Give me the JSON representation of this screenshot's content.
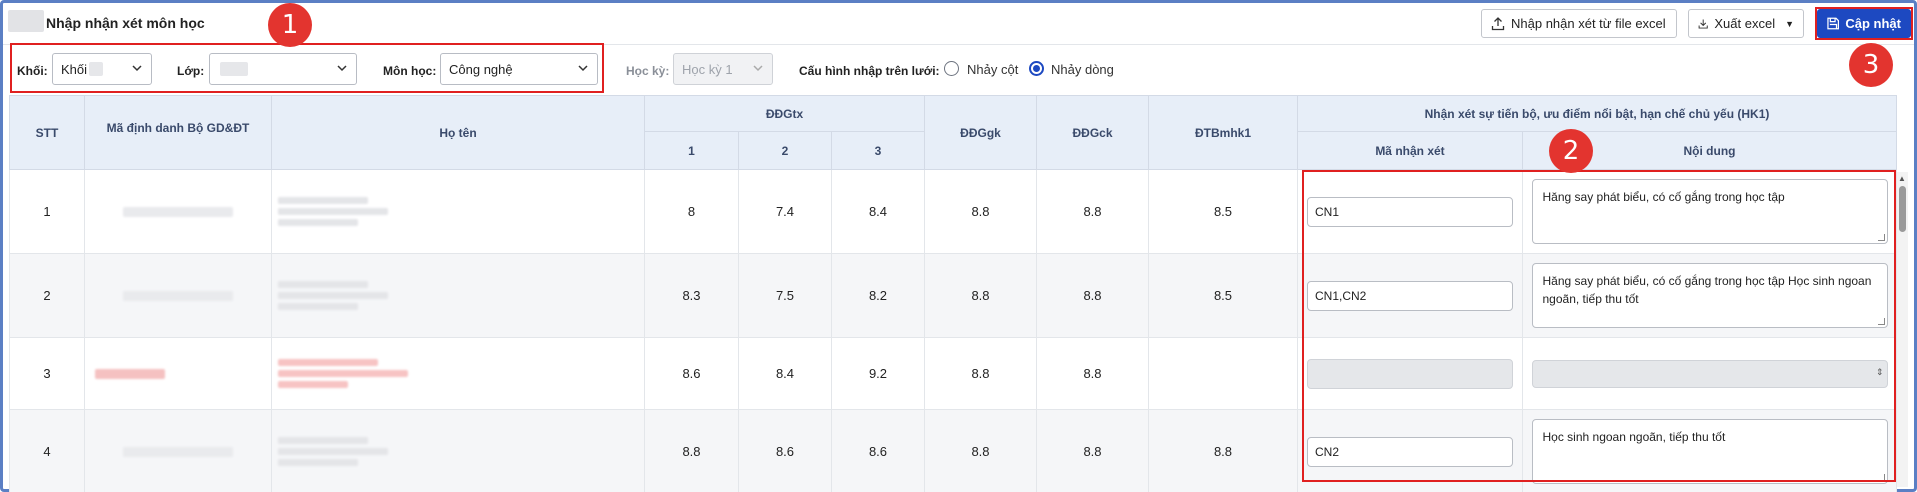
{
  "header": {
    "title": "Nhập nhận xét môn học",
    "import_label": "Nhập nhận xét từ file excel",
    "export_label": "Xuất excel",
    "update_label": "Cập nhật"
  },
  "filters": {
    "khoi_label": "Khối:",
    "khoi_value": "Khối",
    "lop_label": "Lớp:",
    "lop_value": "",
    "monhoc_label": "Môn học:",
    "monhoc_value": "Công nghệ",
    "hocky_label": "Học kỳ:",
    "hocky_value": "Học kỳ 1",
    "config_label": "Cấu hình nhập trên lưới:",
    "radio_col_label": "Nhảy cột",
    "radio_row_label": "Nhảy dòng",
    "radio_selected": "Nhảy dòng"
  },
  "table": {
    "headers": {
      "stt": "STT",
      "ma_dinh_danh": "Mã định danh Bộ GD&ĐT",
      "ho_ten": "Họ tên",
      "ddgtx": "ĐĐGtx",
      "ddgtx_1": "1",
      "ddgtx_2": "2",
      "ddgtx_3": "3",
      "ddggk": "ĐĐGgk",
      "ddgck": "ĐĐGck",
      "dtbmhk1": "ĐTBmhk1",
      "nhan_xet_group": "Nhận xét sự tiến bộ, ưu điểm nổi bật, hạn chế chủ yếu (HK1)",
      "ma_nhan_xet": "Mã nhận xét",
      "noi_dung": "Nội dung"
    },
    "rows": [
      {
        "stt": "1",
        "tx1": "8",
        "tx2": "7.4",
        "tx3": "8.4",
        "gk": "8.8",
        "ck": "8.8",
        "tb": "8.5",
        "ma": "CN1",
        "noidung": "Hăng say phát biểu, có cố gắng trong học tập"
      },
      {
        "stt": "2",
        "tx1": "8.3",
        "tx2": "7.5",
        "tx3": "8.2",
        "gk": "8.8",
        "ck": "8.8",
        "tb": "8.5",
        "ma": "CN1,CN2",
        "noidung": "Hăng say phát biểu, có cố gắng trong học tập Học sinh ngoan ngoãn, tiếp thu tốt"
      },
      {
        "stt": "3",
        "tx1": "8.6",
        "tx2": "8.4",
        "tx3": "9.2",
        "gk": "8.8",
        "ck": "8.8",
        "tb": "",
        "ma": "",
        "noidung": ""
      },
      {
        "stt": "4",
        "tx1": "8.8",
        "tx2": "8.6",
        "tx3": "8.6",
        "gk": "8.8",
        "ck": "8.8",
        "tb": "8.8",
        "ma": "CN2",
        "noidung": "Học sinh ngoan ngoãn, tiếp thu tốt"
      }
    ]
  },
  "annotations": {
    "badge1": "1",
    "badge2": "2",
    "badge3": "3"
  },
  "colors": {
    "primary": "#1d49c1",
    "header_bg": "#e7eef8",
    "annotation_red": "#e02020"
  },
  "icons": {
    "import": "upload-icon",
    "export": "download-icon",
    "update": "save-icon"
  }
}
